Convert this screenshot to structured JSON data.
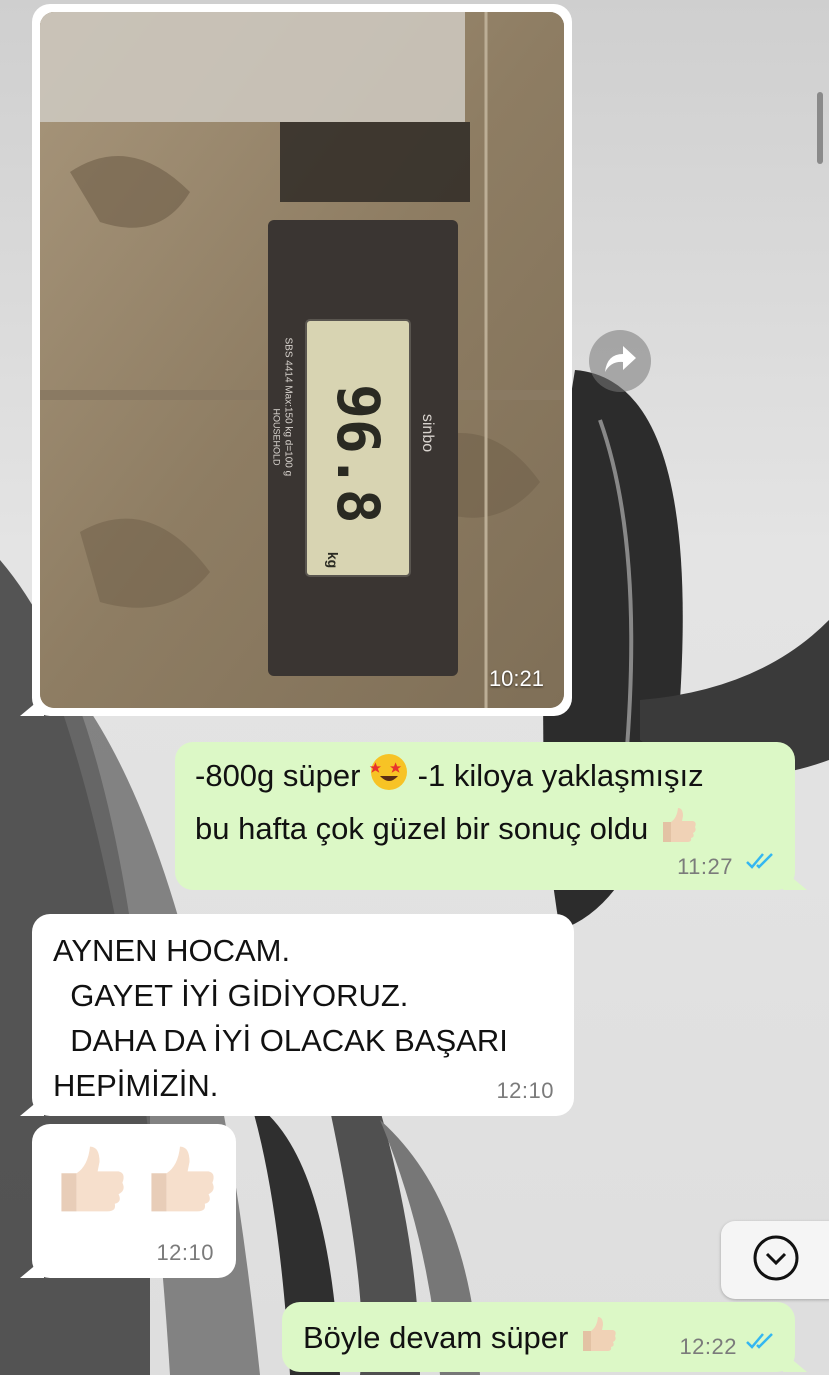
{
  "messages": {
    "photo": {
      "time": "10:21",
      "scale_brand": "sinbo",
      "scale_reading": "96.8",
      "scale_unit": "kg",
      "scale_spec": "SBS 4414 Max:150 kg d=100 g",
      "scale_household": "HOUSEHOLD"
    },
    "out_1": {
      "line1_a": "-800g süper ",
      "line1_b": " -1 kiloya yaklaşmışız",
      "line2": "bu hafta çok güzel bir sonuç oldu ",
      "time": "11:27",
      "emoji_1": "star-struck-emoji",
      "emoji_2": "thumbs-up-emoji"
    },
    "in_1": {
      "text": "AYNEN HOCAM.\n  GAYET İYİ GİDİYORUZ.\n  DAHA DA İYİ OLACAK BAŞARI\nHEPİMİZİN.",
      "time": "12:10"
    },
    "in_2": {
      "time": "12:10",
      "emoji": "thumbs-up-emoji"
    },
    "out_2": {
      "text": "Böyle devam süper ",
      "time": "12:22",
      "emoji": "thumbs-up-emoji"
    }
  },
  "colors": {
    "outgoing_bubble": "#dcf8c6",
    "incoming_bubble": "#ffffff",
    "read_ticks": "#34b7f1"
  },
  "icons": {
    "forward": "forward-icon",
    "scroll_down": "chevron-down-icon",
    "read_receipt": "double-check-icon"
  }
}
